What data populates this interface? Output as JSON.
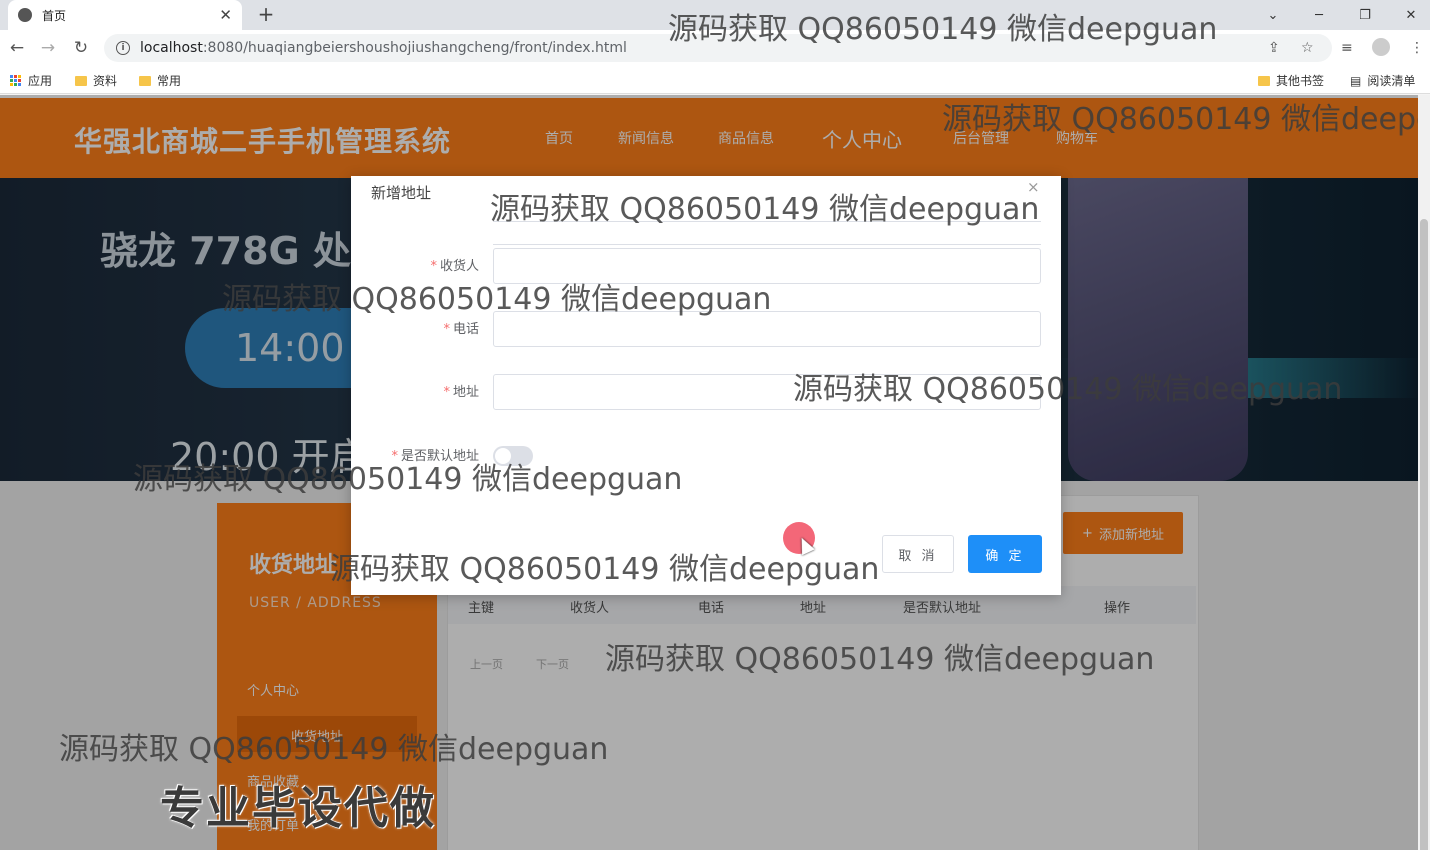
{
  "browser": {
    "tab_title": "首页",
    "tab_close": "✕",
    "new_tab": "+",
    "url_host": "localhost",
    "url_path": ":8080/huaqiangbeiershoushojiushangcheng/front/index.html",
    "bookmarks": [
      "应用",
      "资料",
      "常用"
    ],
    "bookmarks_right": [
      "其他书签",
      "阅读清单"
    ]
  },
  "site": {
    "title": "华强北商城二手手机管理系统",
    "nav": [
      "首页",
      "新闻信息",
      "商品信息",
      "个人中心",
      "后台管理",
      "购物车"
    ]
  },
  "banner": {
    "line1": "骁龙 778G 处",
    "line2": "14:00",
    "line3": "20:00 开启"
  },
  "sidebar": {
    "title": "收货地址",
    "subtitle": "USER / ADDRESS",
    "items": [
      "个人中心",
      "收货地址",
      "商品收藏",
      "我的订单"
    ]
  },
  "main": {
    "add_button": "添加新地址",
    "table_headers": [
      "主键",
      "收货人",
      "电话",
      "地址",
      "是否默认地址",
      "操作"
    ],
    "pager": [
      "上一页",
      "下一页"
    ]
  },
  "dialog": {
    "title": "新增地址",
    "close": "×",
    "fields": [
      {
        "label": "收货人",
        "required": "*"
      },
      {
        "label": "电话",
        "required": "*"
      },
      {
        "label": "地址",
        "required": "*"
      },
      {
        "label": "是否默认地址",
        "required": "*"
      }
    ],
    "cancel": "取 消",
    "confirm": "确 定"
  },
  "watermark": "源码获取 QQ86050149 微信deepguan",
  "caption": "专业毕设代做",
  "colors": {
    "brand": "#ff7f1a",
    "primary": "#1e8ff8"
  }
}
